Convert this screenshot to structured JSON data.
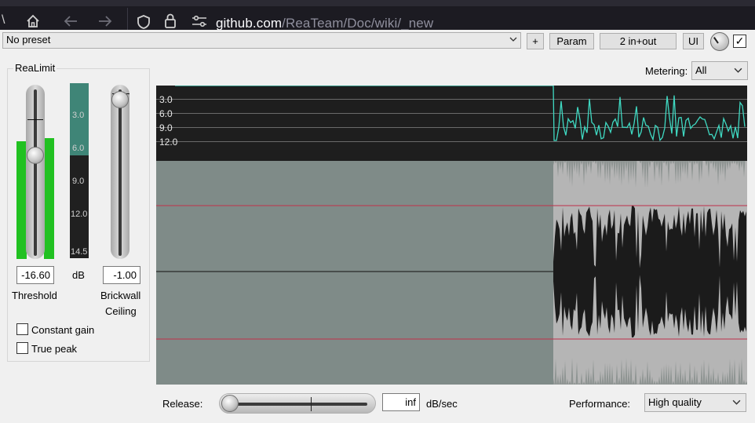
{
  "browser": {
    "url_host": "github.com",
    "url_path": "/ReaTeam/Doc/wiki/_new"
  },
  "toolbar": {
    "preset_value": "No preset",
    "add_label": "+",
    "param_label": "Param",
    "io_label": "2 in+out",
    "ui_label": "UI",
    "bypass_checked": "✓"
  },
  "fx": {
    "title": "ReaLimit",
    "gr_ticks": [
      "3.0",
      "6.0",
      "9.0",
      "12.0",
      "14.5"
    ],
    "threshold_value": "-16.60",
    "threshold_label": "Threshold",
    "db_label": "dB",
    "ceiling_value": "-1.00",
    "ceiling_label_1": "Brickwall",
    "ceiling_label_2": "Ceiling",
    "constant_gain_label": "Constant gain",
    "true_peak_label": "True peak"
  },
  "metering": {
    "label": "Metering:",
    "value": "All"
  },
  "graph": {
    "gr_labels": [
      "3.0",
      "6.0",
      "9.0",
      "12.0"
    ],
    "accent_color": "#3fd9c2",
    "threshold_line_color": "#c0304a"
  },
  "bottom": {
    "release_label": "Release:",
    "release_value": "inf",
    "release_unit": "dB/sec",
    "performance_label": "Performance:",
    "performance_value": "High quality"
  }
}
